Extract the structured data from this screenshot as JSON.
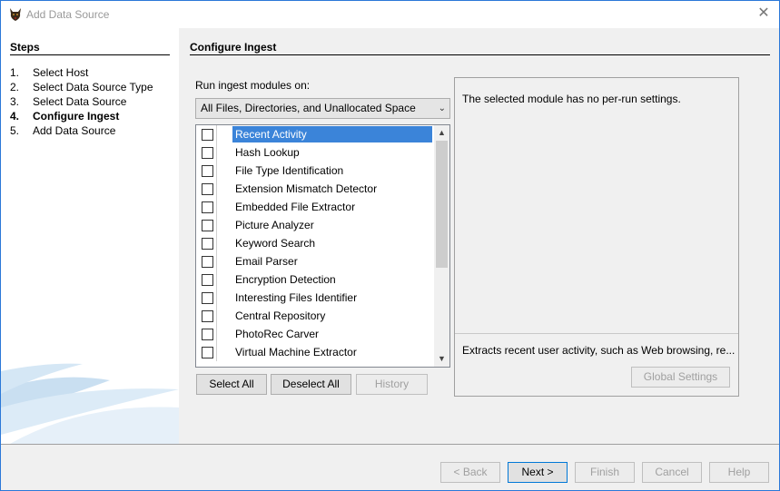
{
  "window": {
    "title": "Add Data Source",
    "close_glyph": "✕"
  },
  "steps": {
    "title": "Steps",
    "items": [
      {
        "num": "1.",
        "label": "Select Host"
      },
      {
        "num": "2.",
        "label": "Select Data Source Type"
      },
      {
        "num": "3.",
        "label": "Select Data Source"
      },
      {
        "num": "4.",
        "label": "Configure Ingest"
      },
      {
        "num": "5.",
        "label": "Add Data Source"
      }
    ],
    "current_index": 3
  },
  "configure": {
    "title": "Configure Ingest",
    "run_label": "Run ingest modules on:",
    "run_selected": "All Files, Directories, and Unallocated Space",
    "modules": [
      "Recent Activity",
      "Hash Lookup",
      "File Type Identification",
      "Extension Mismatch Detector",
      "Embedded File Extractor",
      "Picture Analyzer",
      "Keyword Search",
      "Email Parser",
      "Encryption Detection",
      "Interesting Files Identifier",
      "Central Repository",
      "PhotoRec Carver",
      "Virtual Machine Extractor"
    ],
    "selected_module": 0,
    "buttons": {
      "select_all": "Select All",
      "deselect_all": "Deselect All",
      "history": "History"
    },
    "settings_text": "The selected module has no per-run settings.",
    "module_description": "Extracts recent user activity, such as Web browsing, re...",
    "global_settings": "Global Settings"
  },
  "footer": {
    "back": "< Back",
    "next": "Next >",
    "finish": "Finish",
    "cancel": "Cancel",
    "help": "Help"
  },
  "colors": {
    "accent": "#0078d7",
    "selection": "#3b84d9"
  },
  "icons": {
    "app": "sleuthkit-dog-icon",
    "close": "close-icon",
    "combo": "chevron-down-icon"
  }
}
